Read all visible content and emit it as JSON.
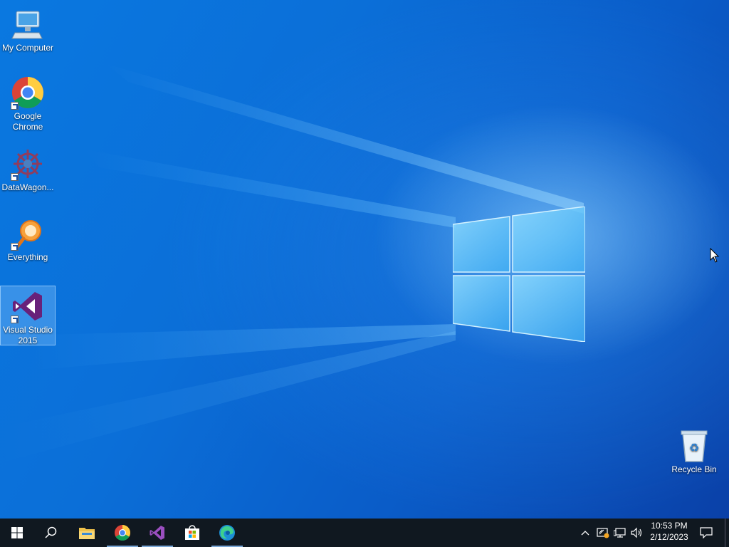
{
  "desktop": {
    "icons": [
      {
        "label": "My Computer",
        "icon": "computer-icon"
      },
      {
        "label": "Google Chrome",
        "icon": "chrome-icon",
        "shortcut": true
      },
      {
        "label": "DataWagon...",
        "icon": "datawagon-icon",
        "shortcut": true
      },
      {
        "label": "Everything",
        "icon": "everything-search-icon",
        "shortcut": true
      },
      {
        "label": "Visual Studio 2015",
        "icon": "visual-studio-icon",
        "shortcut": true,
        "selected": true
      },
      {
        "label": "Recycle Bin",
        "icon": "recycle-bin-icon"
      }
    ]
  },
  "taskbar": {
    "pinned": [
      {
        "name": "start",
        "icon": "windows-start-icon"
      },
      {
        "name": "search",
        "icon": "search-icon"
      },
      {
        "name": "file-explorer",
        "icon": "folder-icon"
      },
      {
        "name": "chrome",
        "icon": "chrome-icon",
        "running": true
      },
      {
        "name": "visual-studio",
        "icon": "visual-studio-icon",
        "running": true
      },
      {
        "name": "store",
        "icon": "store-icon"
      },
      {
        "name": "edge",
        "icon": "edge-icon",
        "running": true
      }
    ],
    "tray": {
      "icons": [
        "chevron-up-icon",
        "security-icon",
        "network-icon",
        "volume-icon"
      ],
      "time": "10:53 PM",
      "date": "2/12/2023",
      "notification_icon": "notification-icon"
    }
  },
  "colors": {
    "accent": "#0b6fd8",
    "taskbar": "#101820",
    "vs_purple": "#68217a"
  }
}
